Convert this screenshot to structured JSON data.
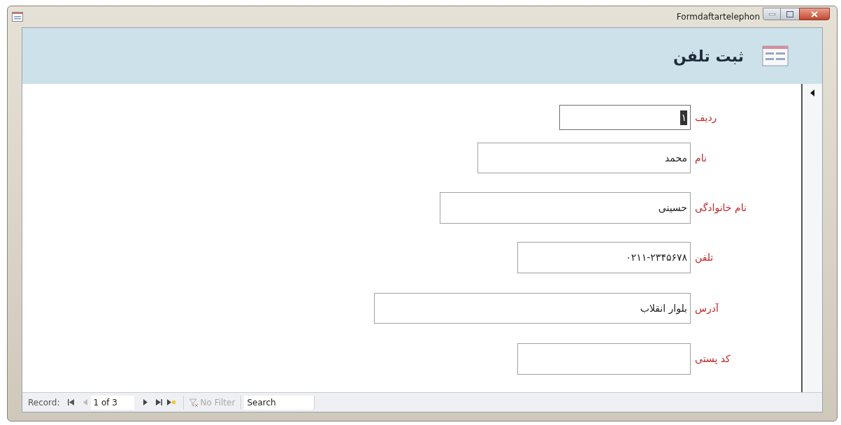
{
  "window": {
    "title": "Formdaftartelephon"
  },
  "form_header": {
    "title": "ثبت تلفن"
  },
  "fields": [
    {
      "label": "ردیف",
      "value": "۱",
      "focused": true
    },
    {
      "label": "نام",
      "value": "محمد",
      "focused": false
    },
    {
      "label": "نام خانوادگی",
      "value": "حسینی",
      "focused": false
    },
    {
      "label": "تلفن",
      "value": "۰۲۱۱-۲۳۴۵۶۷۸",
      "focused": false
    },
    {
      "label": "آدرس",
      "value": "بلوار انقلاب",
      "focused": false
    },
    {
      "label": "کد پستی",
      "focused": false
    }
  ],
  "navigation": {
    "label": "Record:",
    "position": "1 of 3",
    "filter": {
      "label": "No Filter",
      "disabled": true
    },
    "search": {
      "placeholder": "Search"
    }
  }
}
